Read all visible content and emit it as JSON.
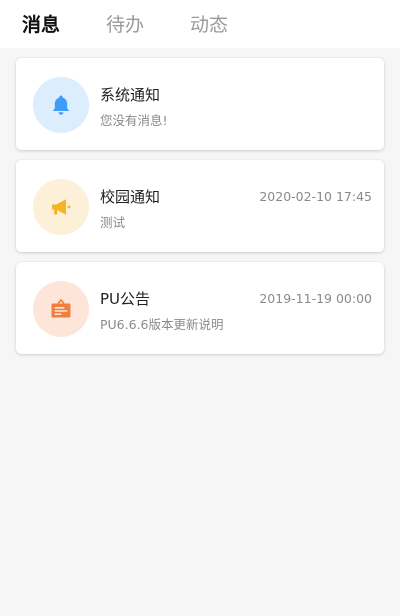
{
  "tabs": [
    {
      "label": "消息",
      "active": true
    },
    {
      "label": "待办",
      "active": false
    },
    {
      "label": "动态",
      "active": false
    }
  ],
  "notifications": [
    {
      "title": "系统通知",
      "subtitle": "您没有消息!",
      "time": "",
      "icon": "bell-icon",
      "icon_color": "#3d9cf5",
      "icon_bg": "#dcedfd"
    },
    {
      "title": "校园通知",
      "subtitle": "测试",
      "time": "2020-02-10 17:45",
      "icon": "megaphone-icon",
      "icon_color": "#f5b328",
      "icon_bg": "#fdf0d9"
    },
    {
      "title": "PU公告",
      "subtitle": "PU6.6.6版本更新说明",
      "time": "2019-11-19 00:00",
      "icon": "notice-board-icon",
      "icon_color": "#f07e3c",
      "icon_bg": "#fde6d9"
    }
  ]
}
